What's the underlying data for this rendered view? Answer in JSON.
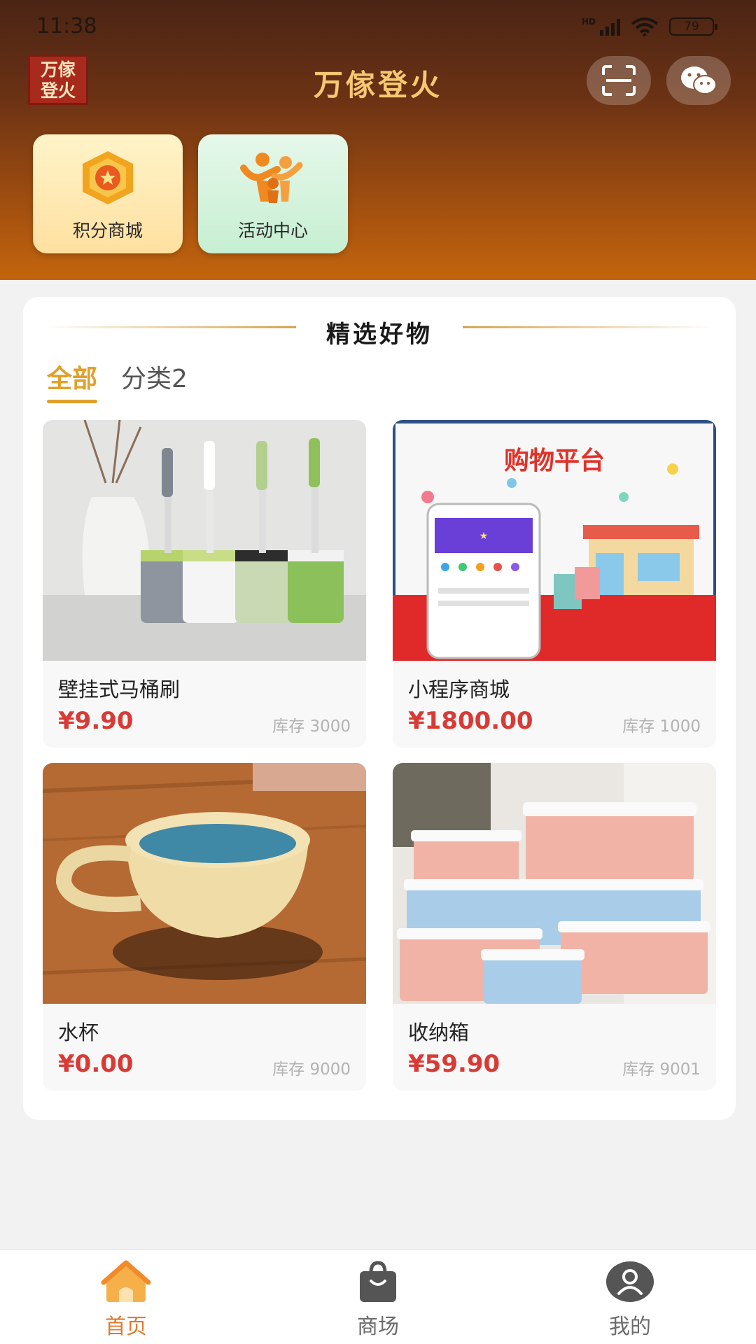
{
  "status_bar": {
    "time": "11:38",
    "network": "HD",
    "battery": "79"
  },
  "header": {
    "logo_text": "万傢\n登火",
    "app_title": "万傢登火",
    "scan_icon": "scan-icon",
    "wechat_icon": "wechat-icon"
  },
  "quick_links": [
    {
      "label": "积分商城",
      "icon": "medal-star-icon",
      "color": "#f0a020"
    },
    {
      "label": "活动中心",
      "icon": "people-group-icon",
      "color": "#f08a20"
    }
  ],
  "featured": {
    "title": "精选好物",
    "tabs": [
      {
        "label": "全部",
        "active": true
      },
      {
        "label": "分类2",
        "active": false
      }
    ],
    "products": [
      {
        "name": "壁挂式马桶刷",
        "price": "¥9.90",
        "stock": "库存 3000"
      },
      {
        "name": "小程序商城",
        "price": "¥1800.00",
        "stock": "库存 1000",
        "image_text": "购物平台"
      },
      {
        "name": "水杯",
        "price": "¥0.00",
        "stock": "库存 9000"
      },
      {
        "name": "收纳箱",
        "price": "¥59.90",
        "stock": "库存 9001"
      }
    ]
  },
  "bottom_nav": [
    {
      "label": "首页",
      "icon": "home-icon",
      "active": true
    },
    {
      "label": "商场",
      "icon": "shopping-bag-icon",
      "active": false
    },
    {
      "label": "我的",
      "icon": "user-icon",
      "active": false
    }
  ],
  "colors": {
    "accent": "#e0a02a",
    "price": "#d93a35",
    "nav_active": "#e07a2e"
  }
}
